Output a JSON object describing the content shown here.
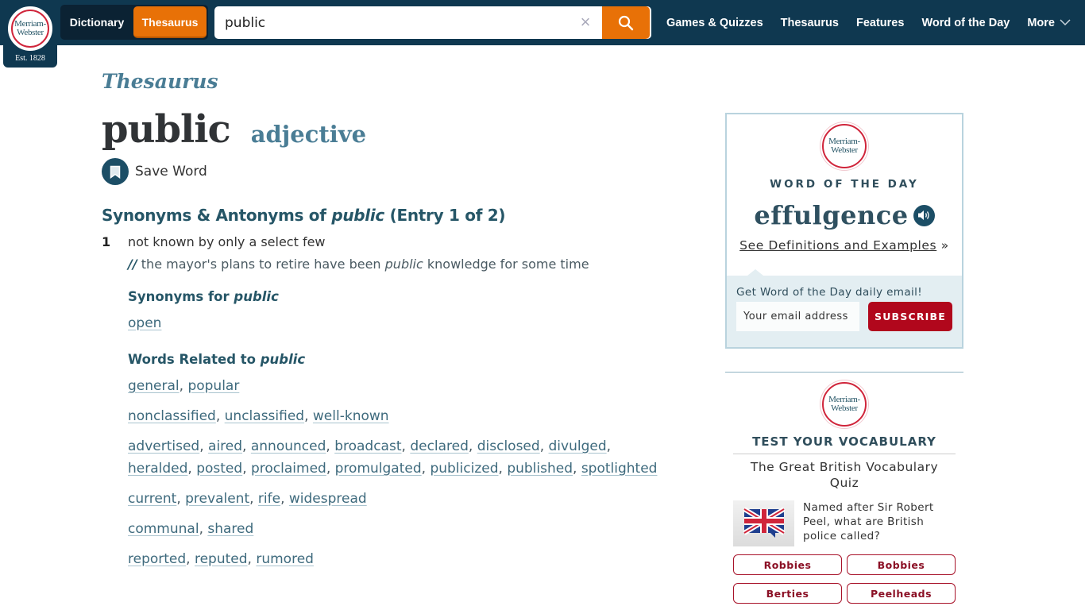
{
  "header": {
    "logo": {
      "line1": "Merriam-",
      "line2": "Webster",
      "est": "Est. 1828"
    },
    "switch": {
      "dictionary": "Dictionary",
      "thesaurus": "Thesaurus",
      "active": "Thesaurus"
    },
    "search": {
      "value": "public",
      "placeholder": "",
      "clear_icon": "close-icon",
      "submit_icon": "search-icon"
    },
    "nav": [
      {
        "label": "Games & Quizzes"
      },
      {
        "label": "Thesaurus"
      },
      {
        "label": "Features"
      },
      {
        "label": "Word of the Day"
      },
      {
        "label": "More",
        "icon": "chevron-down-icon"
      }
    ]
  },
  "main": {
    "kicker": "Thesaurus",
    "headword": "public",
    "pos": "adjective",
    "save_label": "Save Word",
    "section_title": {
      "prefix": "Synonyms & Antonyms of ",
      "word": "public",
      "suffix": " (Entry 1 of 2)"
    },
    "senses": [
      {
        "number": "1",
        "definition": "not known by only a select few",
        "example": {
          "marker": "//",
          "before": " the mayor's plans to retire have been ",
          "word": "public",
          "after": " knowledge for some time"
        },
        "synonyms_heading": {
          "prefix": "Synonyms for ",
          "word": "public"
        },
        "synonyms": [
          "open"
        ],
        "related_heading": {
          "prefix": "Words Related to ",
          "word": "public"
        },
        "related_groups": [
          [
            "general",
            "popular"
          ],
          [
            "nonclassified",
            "unclassified",
            "well-known"
          ],
          [
            "advertised",
            "aired",
            "announced",
            "broadcast",
            "declared",
            "disclosed",
            "divulged",
            "heralded",
            "posted",
            "proclaimed",
            "promulgated",
            "publicized",
            "published",
            "spotlighted"
          ],
          [
            "current",
            "prevalent",
            "rife",
            "widespread"
          ],
          [
            "communal",
            "shared"
          ],
          [
            "reported",
            "reputed",
            "rumored"
          ]
        ]
      }
    ]
  },
  "sidebar": {
    "wotd": {
      "badge": {
        "line1": "Merriam-",
        "line2": "Webster"
      },
      "label": "WORD OF THE DAY",
      "word": "effulgence",
      "link": "See Definitions and Examples",
      "link_suffix": " »",
      "email_prompt": "Get Word of the Day daily email!",
      "email_placeholder": "Your email address",
      "subscribe": "SUBSCRIBE"
    },
    "quiz": {
      "badge": {
        "line1": "Merriam-",
        "line2": "Webster"
      },
      "label": "TEST YOUR VOCABULARY",
      "title": "The Great British Vocabulary Quiz",
      "question": "Named after Sir Robert Peel, what are British police called?",
      "answers": [
        "Robbies",
        "Bobbies",
        "Berties",
        "Peelheads"
      ]
    }
  },
  "colors": {
    "navy": "#0f3850",
    "orange": "#e87107",
    "teal": "#265667",
    "link": "#3e6a7d",
    "subscribe_red": "#b1071c"
  }
}
